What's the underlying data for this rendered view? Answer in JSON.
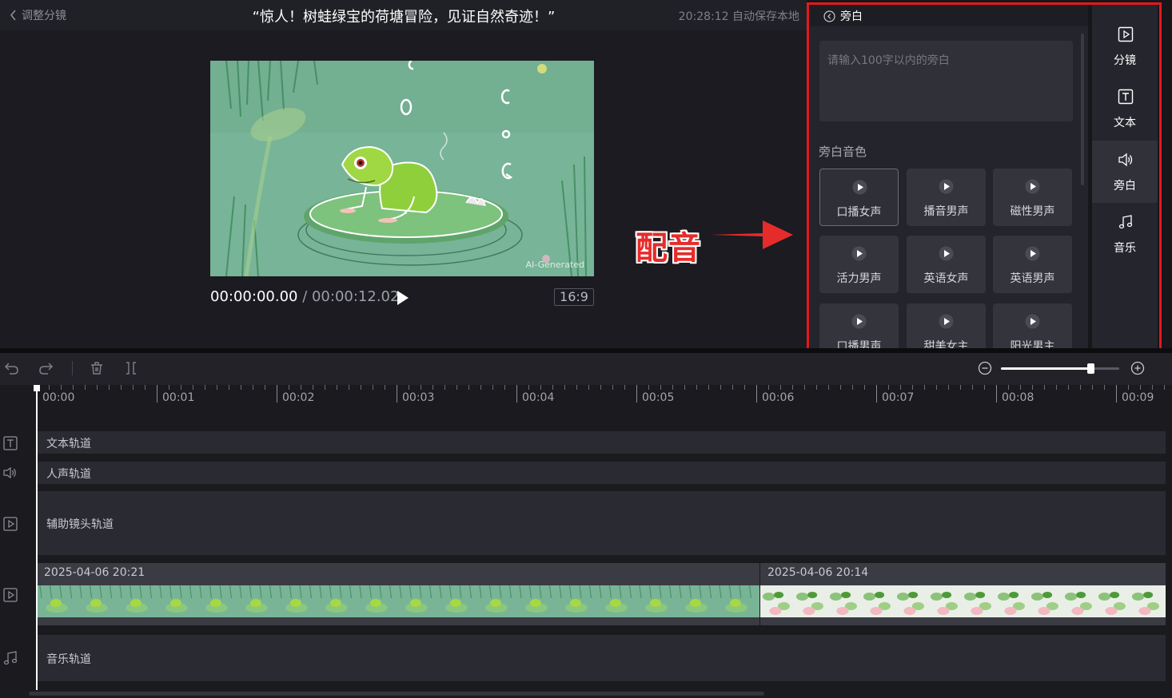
{
  "header": {
    "back_label": "调整分镜",
    "title": "“惊人！树蛙绿宝的荷塘冒险，见证自然奇迹！”",
    "autosave": "20:28:12 自动保存本地"
  },
  "preview": {
    "watermark": "AI-Generated",
    "current_time": "00:00:00.00",
    "separator": " / ",
    "total_time": "00:00:12.02",
    "aspect_ratio": "16:9"
  },
  "annotation": {
    "label": "配音",
    "color": "#e62b2b"
  },
  "narration": {
    "back_label": "旁白",
    "placeholder": "请输入100字以内的旁白",
    "voice_section_label": "旁白音色",
    "voices": [
      {
        "label": "口播女声"
      },
      {
        "label": "播音男声"
      },
      {
        "label": "磁性男声"
      },
      {
        "label": "活力男声"
      },
      {
        "label": "英语女声"
      },
      {
        "label": "英语男声"
      },
      {
        "label": "口播男声"
      },
      {
        "label": "甜美女主"
      },
      {
        "label": "阳光男主"
      }
    ]
  },
  "toolbar": {
    "items": [
      {
        "label": "分镜",
        "icon": "play-square-icon"
      },
      {
        "label": "文本",
        "icon": "text-icon"
      },
      {
        "label": "旁白",
        "icon": "speaker-icon"
      },
      {
        "label": "音乐",
        "icon": "music-note-icon"
      }
    ]
  },
  "timeline": {
    "ruler_labels": [
      "00:00",
      "00:01",
      "00:02",
      "00:03",
      "00:04",
      "00:05",
      "00:06",
      "00:07",
      "00:08",
      "00:09"
    ],
    "tracks": {
      "text": "文本轨道",
      "voice": "人声轨道",
      "aux": "辅助镜头轨道",
      "music": "音乐轨道"
    },
    "clips": [
      {
        "date": "2025-04-06 20:21"
      },
      {
        "date": "2025-04-06 20:14"
      }
    ]
  },
  "colors": {
    "accent_red": "#e3191c",
    "background": "#16161b",
    "panel": "#24252c"
  }
}
